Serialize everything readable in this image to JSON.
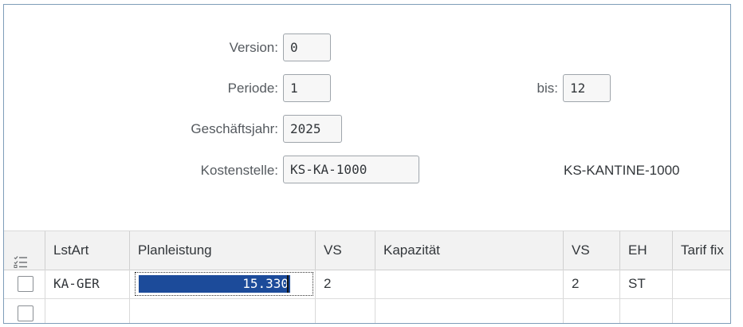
{
  "header": {
    "version": {
      "label": "Version:",
      "value": "0"
    },
    "periode": {
      "label": "Periode:",
      "value": "1"
    },
    "bis": {
      "label": "bis:",
      "value": "12"
    },
    "geschaeftsjahr": {
      "label": "Geschäftsjahr:",
      "value": "2025"
    },
    "kostenstelle": {
      "label": "Kostenstelle:",
      "value": "KS-KA-1000",
      "description": "KS-KANTINE-1000"
    }
  },
  "table": {
    "columns": [
      "LstArt",
      "Planleistung",
      "VS",
      "Kapazität",
      "VS",
      "EH",
      "Tarif fix"
    ],
    "rows": [
      {
        "lstart": "KA-GER",
        "planleistung": "15.330",
        "vs1": "2",
        "kapazitaet": "",
        "vs2": "2",
        "eh": "ST",
        "tarif_fix": ""
      },
      {
        "lstart": "",
        "planleistung": "",
        "vs1": "",
        "kapazitaet": "",
        "vs2": "",
        "eh": "",
        "tarif_fix": ""
      }
    ]
  },
  "icons": {
    "select_all": "list-select-icon",
    "row_checkbox": "checkbox-icon"
  },
  "colors": {
    "selection": "#1c4b9a",
    "header_bg": "#f2f2f2"
  }
}
